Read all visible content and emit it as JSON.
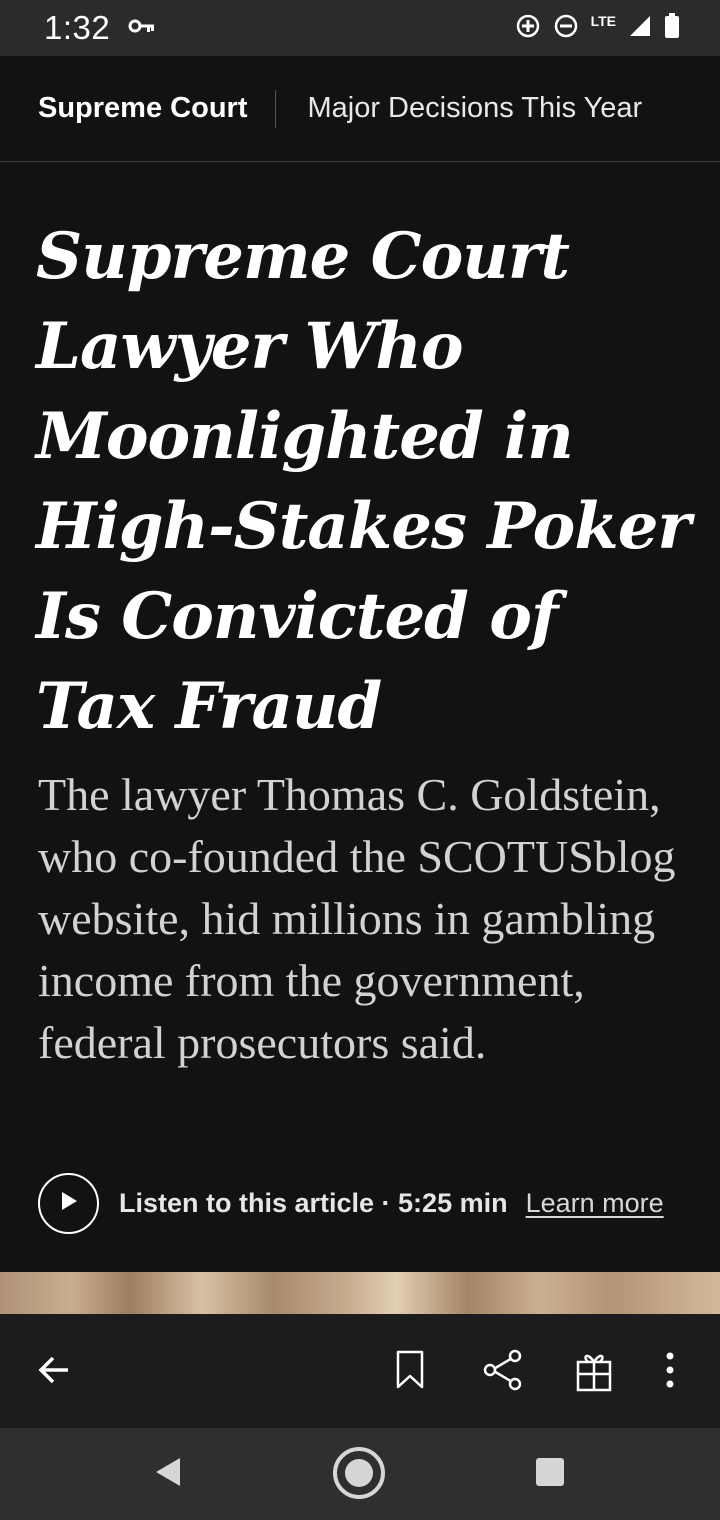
{
  "status_bar": {
    "time": "1:32",
    "network": "LTE"
  },
  "topnav": {
    "section": "Supreme Court",
    "link": "Major Decisions This Year"
  },
  "article": {
    "headline": "Supreme Court Lawyer Who Moonlighted in High-Stakes Poker Is Convicted of Tax Fraud",
    "summary": "The lawyer Thomas C. Goldstein, who co-founded the SCOTUSblog website, hid millions in gambling income from the government, federal prosecutors said."
  },
  "audio": {
    "listen_label": "Listen to this article · 5:25 min",
    "learn_more": "Learn more"
  },
  "toolbar": {
    "icons": [
      "back-arrow-icon",
      "bookmark-icon",
      "share-icon",
      "gift-icon",
      "more-vert-icon"
    ]
  },
  "system_nav": {
    "icons": [
      "nav-back-icon",
      "nav-home-icon",
      "nav-recents-icon"
    ]
  },
  "colors": {
    "background": "#121212",
    "status_bar": "#2b2b2b",
    "toolbar": "#1c1c1c",
    "system_nav": "#2f2f2f",
    "summary_text": "#d2d2d2"
  }
}
